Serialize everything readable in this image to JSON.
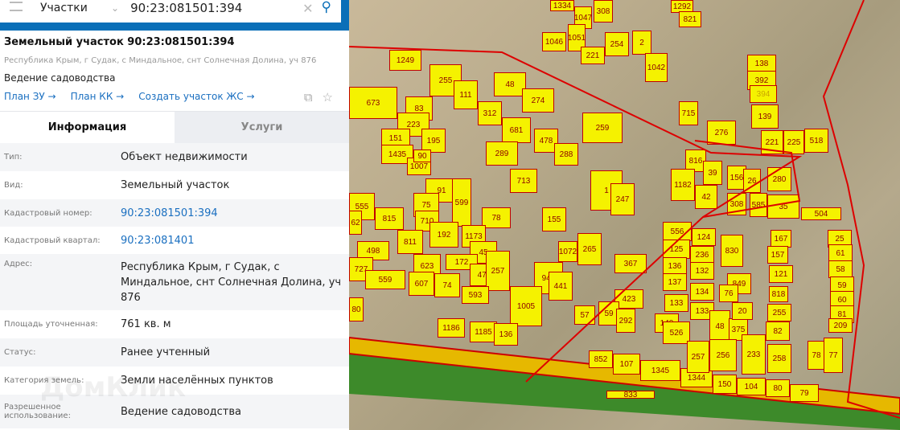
{
  "search": {
    "category": "Участки",
    "query": "90:23:081501:394"
  },
  "header": {
    "title": "Земельный участок 90:23:081501:394",
    "address": "Республика Крым, г Судак, с Миндальное, снт Солнечная Долина, уч 876",
    "usage": "Ведение садоводства"
  },
  "links": [
    "План ЗУ →",
    "План КК →",
    "Создать участок ЖС →"
  ],
  "tabs": [
    "Информация",
    "Услуги"
  ],
  "info": [
    {
      "k": "Тип:",
      "v": "Объект недвижимости"
    },
    {
      "k": "Вид:",
      "v": "Земельный участок"
    },
    {
      "k": "Кадастровый номер:",
      "v": "90:23:081501:394"
    },
    {
      "k": "Кадастровый квартал:",
      "v": "90:23:081401"
    },
    {
      "k": "Адрес:",
      "v": "Республика Крым, г Судак, с Миндальное, снт Солнечная Долина, уч 876"
    },
    {
      "k": "Площадь уточненная:",
      "v": "761 кв. м"
    },
    {
      "k": "Статус:",
      "v": "Ранее учтенный"
    },
    {
      "k": "Категория земель:",
      "v": "Земли населённых пунктов"
    },
    {
      "k": "Разрешенное использование:",
      "v": "Ведение садоводства"
    }
  ],
  "watermark": "ДомКлик",
  "parcels": [
    "1334",
    "1047",
    "308",
    "1292",
    "821",
    "1046",
    "1051",
    "221",
    "254",
    "2",
    "1042",
    "1249",
    "255",
    "111",
    "48",
    "274",
    "138",
    "392",
    "394",
    "139",
    "715",
    "276",
    "673",
    "83",
    "312",
    "681",
    "259",
    "221",
    "225",
    "518",
    "223",
    "195",
    "478",
    "288",
    "289",
    "816",
    "39",
    "156",
    "26",
    "280",
    "151",
    "1435",
    "1007",
    "90",
    "91",
    "599",
    "713",
    "1",
    "247",
    "1182",
    "42",
    "308",
    "585",
    "35",
    "504",
    "555",
    "815",
    "75",
    "710",
    "78",
    "155",
    "556",
    "124",
    "167",
    "25",
    "62",
    "811",
    "192",
    "1173",
    "45",
    "1072",
    "265",
    "367",
    "125",
    "236",
    "830",
    "157",
    "61",
    "498",
    "172",
    "471",
    "257",
    "423",
    "136",
    "132",
    "121",
    "58",
    "727",
    "623",
    "607",
    "74",
    "942",
    "441",
    "137",
    "134",
    "849",
    "59",
    "559",
    "593",
    "1005",
    "57",
    "59",
    "292",
    "133",
    "133",
    "818",
    "255",
    "60",
    "80",
    "81",
    "209",
    "1186",
    "1185",
    "136",
    "140",
    "526",
    "48",
    "375",
    "82",
    "852",
    "107",
    "1345",
    "1344",
    "150",
    "104",
    "80",
    "79",
    "257",
    "256",
    "233",
    "258",
    "78",
    "77",
    "833",
    "76",
    "20"
  ]
}
